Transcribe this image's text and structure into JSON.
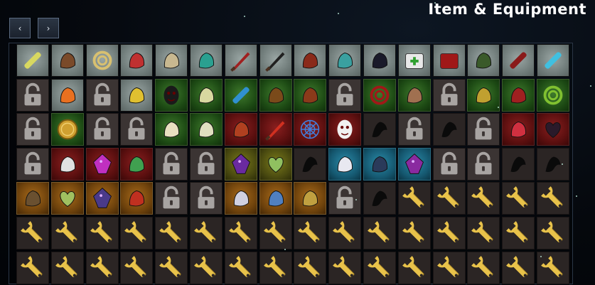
{
  "header": {
    "title": "Item & Equipment",
    "prev_label": "‹",
    "next_label": "›"
  },
  "grid": {
    "rows": [
      [
        {
          "kind": "item",
          "bg": "gray",
          "icon": "syringe-icon",
          "color": "#d8d860"
        },
        {
          "kind": "item",
          "bg": "gray",
          "icon": "teddy-bear-icon",
          "color": "#7a4a2a"
        },
        {
          "kind": "item",
          "bg": "gray",
          "icon": "necklace-icon",
          "color": "#d8c070"
        },
        {
          "kind": "item",
          "bg": "gray",
          "icon": "glasses-icon",
          "color": "#c03030"
        },
        {
          "kind": "item",
          "bg": "gray",
          "icon": "bandage-icon",
          "color": "#c8b890"
        },
        {
          "kind": "item",
          "bg": "gray",
          "icon": "frog-icon",
          "color": "#2aa090"
        },
        {
          "kind": "item",
          "bg": "gray",
          "icon": "crowbar-icon",
          "color": "#a02020"
        },
        {
          "kind": "item",
          "bg": "gray",
          "icon": "knife-icon",
          "color": "#202020"
        },
        {
          "kind": "item",
          "bg": "gray",
          "icon": "antlers-icon",
          "color": "#8a2a1a"
        },
        {
          "kind": "item",
          "bg": "gray",
          "icon": "horn-icon",
          "color": "#3aa0a0"
        },
        {
          "kind": "item",
          "bg": "gray",
          "icon": "crow-skull-icon",
          "color": "#1a1a2a"
        },
        {
          "kind": "item",
          "bg": "gray",
          "icon": "medkit-icon",
          "color": "#e8e8e8"
        },
        {
          "kind": "item",
          "bg": "gray",
          "icon": "red-book-icon",
          "color": "#a01818"
        },
        {
          "kind": "item",
          "bg": "gray",
          "icon": "stun-grenade-icon",
          "color": "#3a5a2a"
        },
        {
          "kind": "item",
          "bg": "gray",
          "icon": "flare-icon",
          "color": "#8a1a1a"
        },
        {
          "kind": "item",
          "bg": "gray",
          "icon": "energy-drink-icon",
          "color": "#40c0e0"
        }
      ],
      [
        {
          "kind": "locked"
        },
        {
          "kind": "item",
          "bg": "gray",
          "icon": "lollipop-icon",
          "color": "#e87020"
        },
        {
          "kind": "locked"
        },
        {
          "kind": "item",
          "bg": "gray",
          "icon": "scissors-icon",
          "color": "#e0c030"
        },
        {
          "kind": "item",
          "bg": "green",
          "icon": "spring-mask-icon",
          "color": "#1a1a1a"
        },
        {
          "kind": "item",
          "bg": "green",
          "icon": "jar-icon",
          "color": "#d8d8a0"
        },
        {
          "kind": "item",
          "bg": "green",
          "icon": "feather-icon",
          "color": "#3090d0"
        },
        {
          "kind": "item",
          "bg": "green",
          "icon": "guitar-icon",
          "color": "#7a4a1a"
        },
        {
          "kind": "item",
          "bg": "green",
          "icon": "mitten-icon",
          "color": "#8a3a1a"
        },
        {
          "kind": "locked"
        },
        {
          "kind": "item",
          "bg": "green",
          "icon": "coiled-whip-icon",
          "color": "#a01818"
        },
        {
          "kind": "item",
          "bg": "green",
          "icon": "fist-icon",
          "color": "#a07050"
        },
        {
          "kind": "locked"
        },
        {
          "kind": "item",
          "bg": "green",
          "icon": "lantern-icon",
          "color": "#c0a030"
        },
        {
          "kind": "item",
          "bg": "green",
          "icon": "hammer-icon",
          "color": "#a02020"
        },
        {
          "kind": "item",
          "bg": "green",
          "icon": "chain-icon",
          "color": "#80c030"
        }
      ],
      [
        {
          "kind": "locked"
        },
        {
          "kind": "item",
          "bg": "green",
          "icon": "gold-coin-icon",
          "color": "#d0a030"
        },
        {
          "kind": "locked"
        },
        {
          "kind": "locked"
        },
        {
          "kind": "item",
          "bg": "green",
          "icon": "bomb-pot-icon",
          "color": "#e8e0c0"
        },
        {
          "kind": "item",
          "bg": "green",
          "icon": "dove-icon",
          "color": "#e0e0c0"
        },
        {
          "kind": "item",
          "bg": "red",
          "icon": "shotgun-shells-icon",
          "color": "#b04020"
        },
        {
          "kind": "item",
          "bg": "red",
          "icon": "curved-blade-icon",
          "color": "#d03020"
        },
        {
          "kind": "item",
          "bg": "red",
          "icon": "spiderweb-icon",
          "color": "#4080e0"
        },
        {
          "kind": "item",
          "bg": "red",
          "icon": "smiling-mask-icon",
          "color": "#f0f0f0"
        },
        {
          "kind": "item",
          "bg": "dark",
          "icon": "silhouette-knot-icon",
          "color": "#0a0a0a"
        },
        {
          "kind": "locked"
        },
        {
          "kind": "item",
          "bg": "dark",
          "icon": "silhouette-mushroom-icon",
          "color": "#0a0a0a"
        },
        {
          "kind": "locked"
        },
        {
          "kind": "item",
          "bg": "red",
          "icon": "cuffs-icon",
          "color": "#d03040"
        },
        {
          "kind": "item",
          "bg": "red",
          "icon": "dark-heart-icon",
          "color": "#2a1a2a"
        }
      ],
      [
        {
          "kind": "locked"
        },
        {
          "kind": "item",
          "bg": "red",
          "icon": "gloved-hand-icon",
          "color": "#e0e0e0"
        },
        {
          "kind": "item",
          "bg": "red",
          "icon": "void-gem-icon",
          "color": "#c030c0"
        },
        {
          "kind": "item",
          "bg": "red",
          "icon": "claw-icon",
          "color": "#40a050"
        },
        {
          "kind": "locked"
        },
        {
          "kind": "locked"
        },
        {
          "kind": "item",
          "bg": "olive",
          "icon": "purple-crystal-icon",
          "color": "#6a2aa0"
        },
        {
          "kind": "item",
          "bg": "olive",
          "icon": "green-brain-icon",
          "color": "#90c060"
        },
        {
          "kind": "item",
          "bg": "dark",
          "icon": "silhouette-hook-icon",
          "color": "#0a0a0a"
        },
        {
          "kind": "item",
          "bg": "blue",
          "icon": "glass-vial-icon",
          "color": "#e8e8f0"
        },
        {
          "kind": "item",
          "bg": "blue",
          "icon": "beetle-icon",
          "color": "#2a3a5a"
        },
        {
          "kind": "item",
          "bg": "blue",
          "icon": "cosmic-rune-icon",
          "color": "#8a2aa0"
        },
        {
          "kind": "locked"
        },
        {
          "kind": "locked"
        },
        {
          "kind": "item",
          "bg": "dark",
          "icon": "silhouette-bag-icon",
          "color": "#0a0a0a"
        },
        {
          "kind": "item",
          "bg": "dark",
          "icon": "silhouette-figure-icon",
          "color": "#0a0a0a"
        }
      ],
      [
        {
          "kind": "item",
          "bg": "orange",
          "icon": "rock-golem-icon",
          "color": "#6a5030"
        },
        {
          "kind": "item",
          "bg": "orange",
          "icon": "slime-icon",
          "color": "#a0c060"
        },
        {
          "kind": "item",
          "bg": "orange",
          "icon": "void-cube-icon",
          "color": "#4a3a8a"
        },
        {
          "kind": "item",
          "bg": "orange",
          "icon": "target-gear-icon",
          "color": "#c03020"
        },
        {
          "kind": "locked"
        },
        {
          "kind": "locked"
        },
        {
          "kind": "item",
          "bg": "orange",
          "icon": "bandaged-arm-icon",
          "color": "#d0d0e0"
        },
        {
          "kind": "item",
          "bg": "orange",
          "icon": "drill-icon",
          "color": "#5080c0"
        },
        {
          "kind": "item",
          "bg": "orange",
          "icon": "brass-gadget-icon",
          "color": "#c0a040"
        },
        {
          "kind": "locked"
        },
        {
          "kind": "item",
          "bg": "dark",
          "icon": "silhouette-crack-icon",
          "color": "#0a0a0a"
        },
        {
          "kind": "wrench"
        },
        {
          "kind": "wrench"
        },
        {
          "kind": "wrench"
        },
        {
          "kind": "wrench"
        },
        {
          "kind": "wrench"
        }
      ],
      [
        {
          "kind": "wrench"
        },
        {
          "kind": "wrench"
        },
        {
          "kind": "wrench"
        },
        {
          "kind": "wrench"
        },
        {
          "kind": "wrench"
        },
        {
          "kind": "wrench"
        },
        {
          "kind": "wrench"
        },
        {
          "kind": "wrench"
        },
        {
          "kind": "wrench"
        },
        {
          "kind": "wrench"
        },
        {
          "kind": "wrench"
        },
        {
          "kind": "wrench"
        },
        {
          "kind": "wrench"
        },
        {
          "kind": "wrench"
        },
        {
          "kind": "wrench"
        },
        {
          "kind": "wrench"
        }
      ],
      [
        {
          "kind": "wrench"
        },
        {
          "kind": "wrench"
        },
        {
          "kind": "wrench"
        },
        {
          "kind": "wrench"
        },
        {
          "kind": "wrench"
        },
        {
          "kind": "wrench"
        },
        {
          "kind": "wrench"
        },
        {
          "kind": "wrench"
        },
        {
          "kind": "wrench"
        },
        {
          "kind": "wrench"
        },
        {
          "kind": "wrench"
        },
        {
          "kind": "wrench"
        },
        {
          "kind": "wrench"
        },
        {
          "kind": "wrench"
        },
        {
          "kind": "wrench"
        },
        {
          "kind": "wrench"
        }
      ]
    ]
  },
  "colors": {
    "lock": "#a8a4a2",
    "wrench": "#e8c24a",
    "wrench_shadow": "#a8862a"
  }
}
